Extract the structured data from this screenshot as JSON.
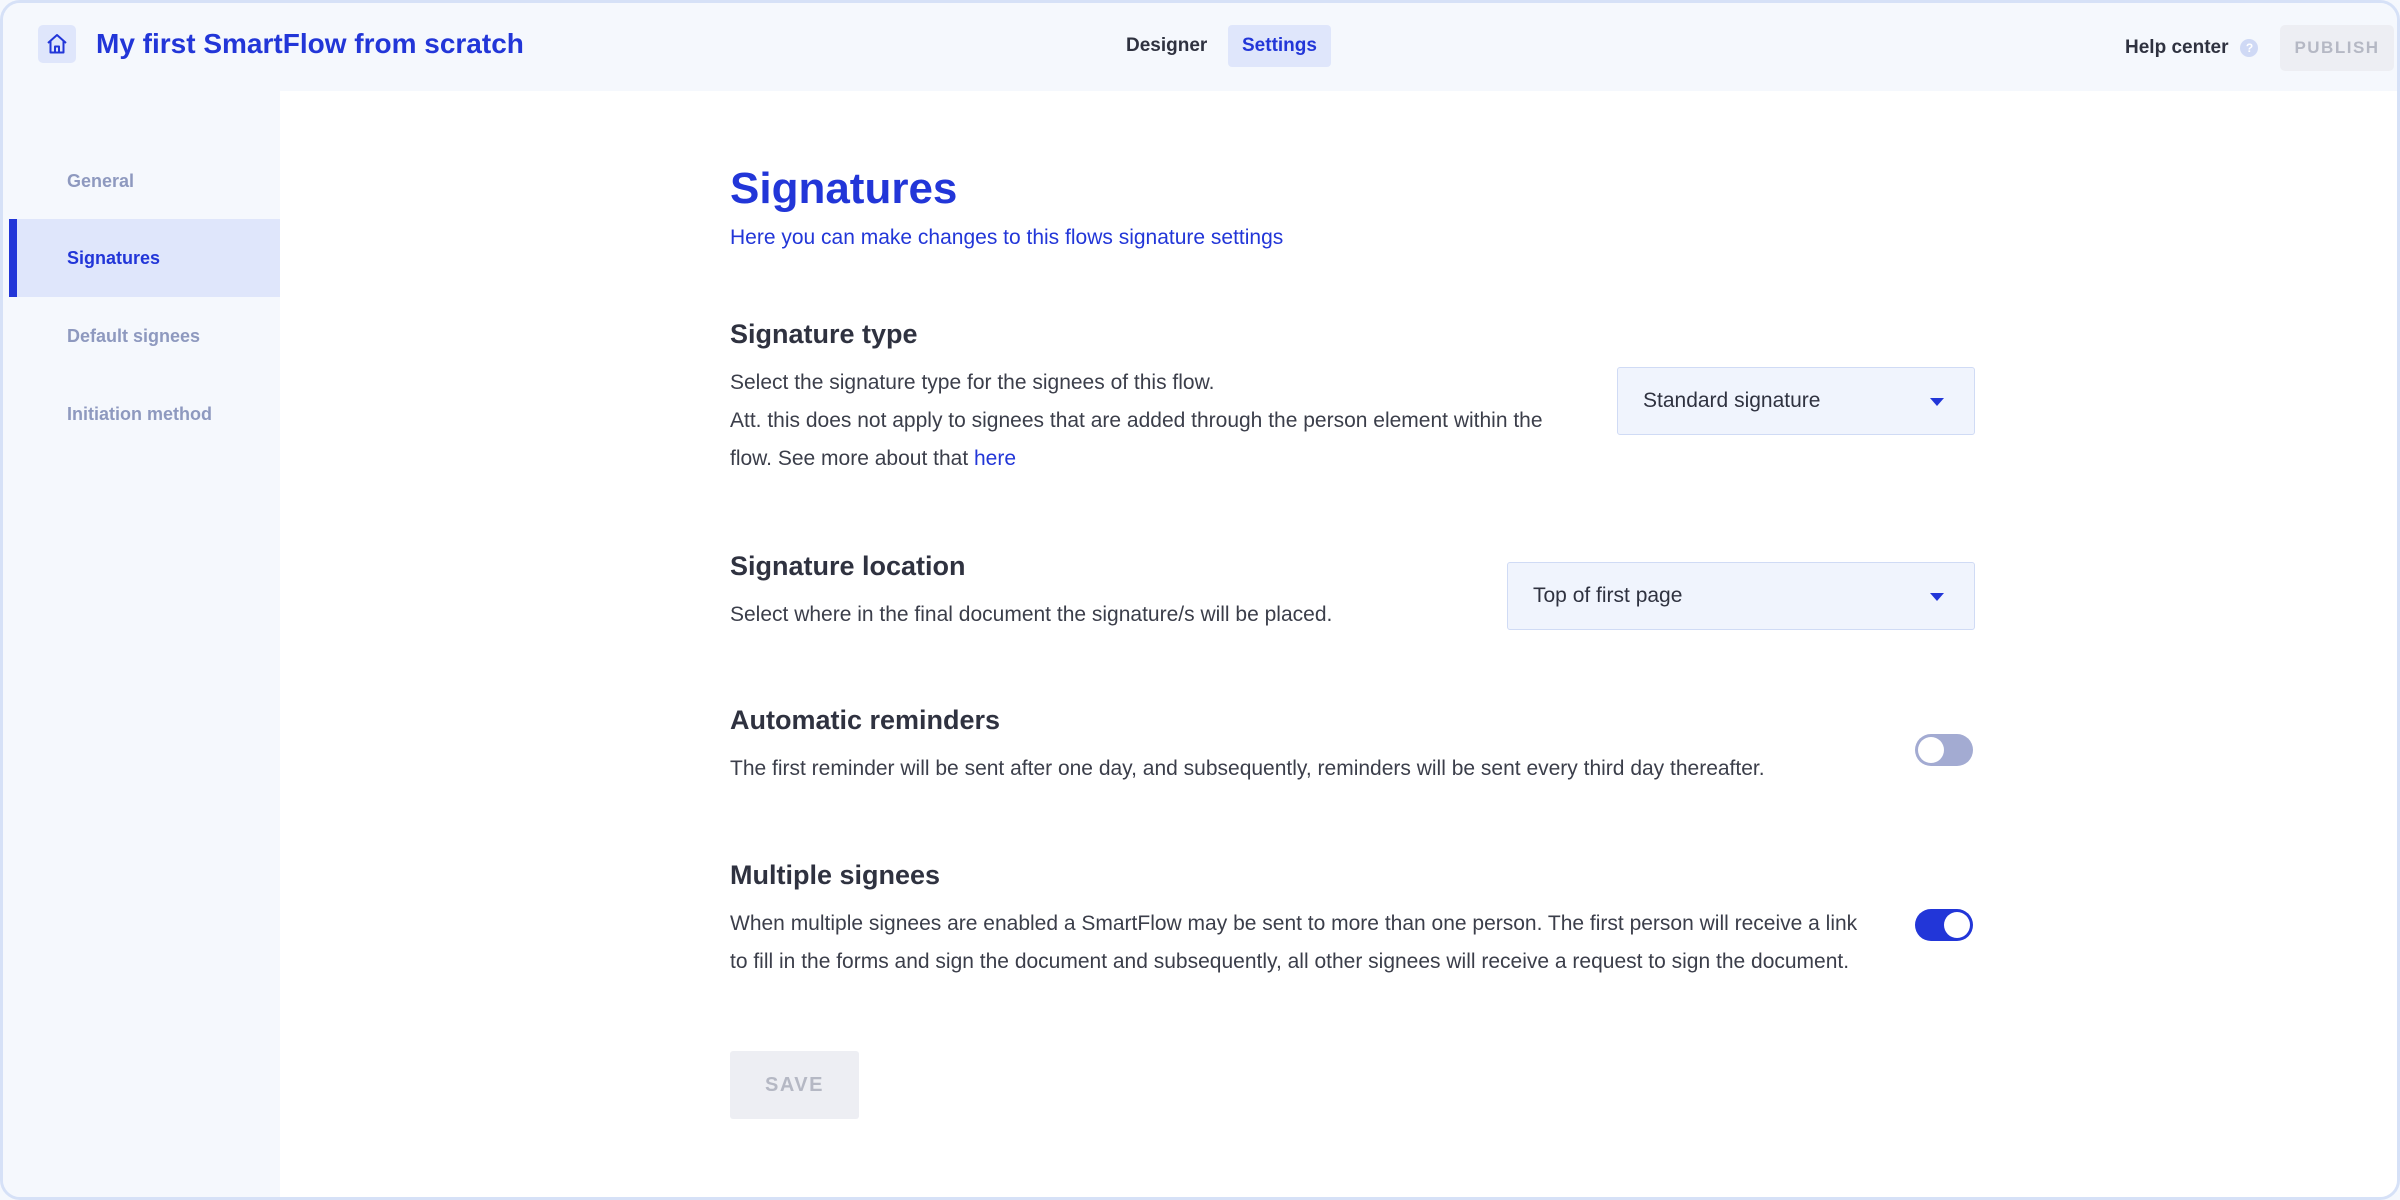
{
  "header": {
    "title": "My first SmartFlow from scratch",
    "tabs": [
      {
        "label": "Designer",
        "active": false
      },
      {
        "label": "Settings",
        "active": true
      }
    ],
    "help_label": "Help center",
    "help_icon": "?",
    "publish_label": "PUBLISH"
  },
  "sidebar": {
    "items": [
      {
        "label": "General",
        "active": false
      },
      {
        "label": "Signatures",
        "active": true
      },
      {
        "label": "Default signees",
        "active": false
      },
      {
        "label": "Initiation method",
        "active": false
      }
    ]
  },
  "page": {
    "title": "Signatures",
    "subtitle": "Here you can make changes to this flows signature settings"
  },
  "sections": {
    "signature_type": {
      "title": "Signature type",
      "desc_line1": "Select the signature type for the signees of this flow.",
      "desc_line2": "Att. this does not apply to signees that are added through the person element within the flow. See more about that",
      "link_text": "here",
      "select_value": "Standard signature"
    },
    "signature_location": {
      "title": "Signature location",
      "desc": "Select where in the final document the signature/s will be placed.",
      "select_value": "Top of first page"
    },
    "automatic_reminders": {
      "title": "Automatic reminders",
      "desc": "The first reminder will be sent after one day, and subsequently, reminders will be sent every third day thereafter.",
      "enabled": false
    },
    "multiple_signees": {
      "title": "Multiple signees",
      "desc": "When multiple signees are enabled a SmartFlow may be sent to more than one person. The first person will receive a link to fill in the forms and sign the document and subsequently, all other signees will receive a request to sign the document.",
      "enabled": true
    }
  },
  "save_label": "SAVE",
  "colors": {
    "accent": "#2236d8",
    "toggle_off": "#a3abd2",
    "sidebar_active_bg": "#dfe6fb"
  }
}
